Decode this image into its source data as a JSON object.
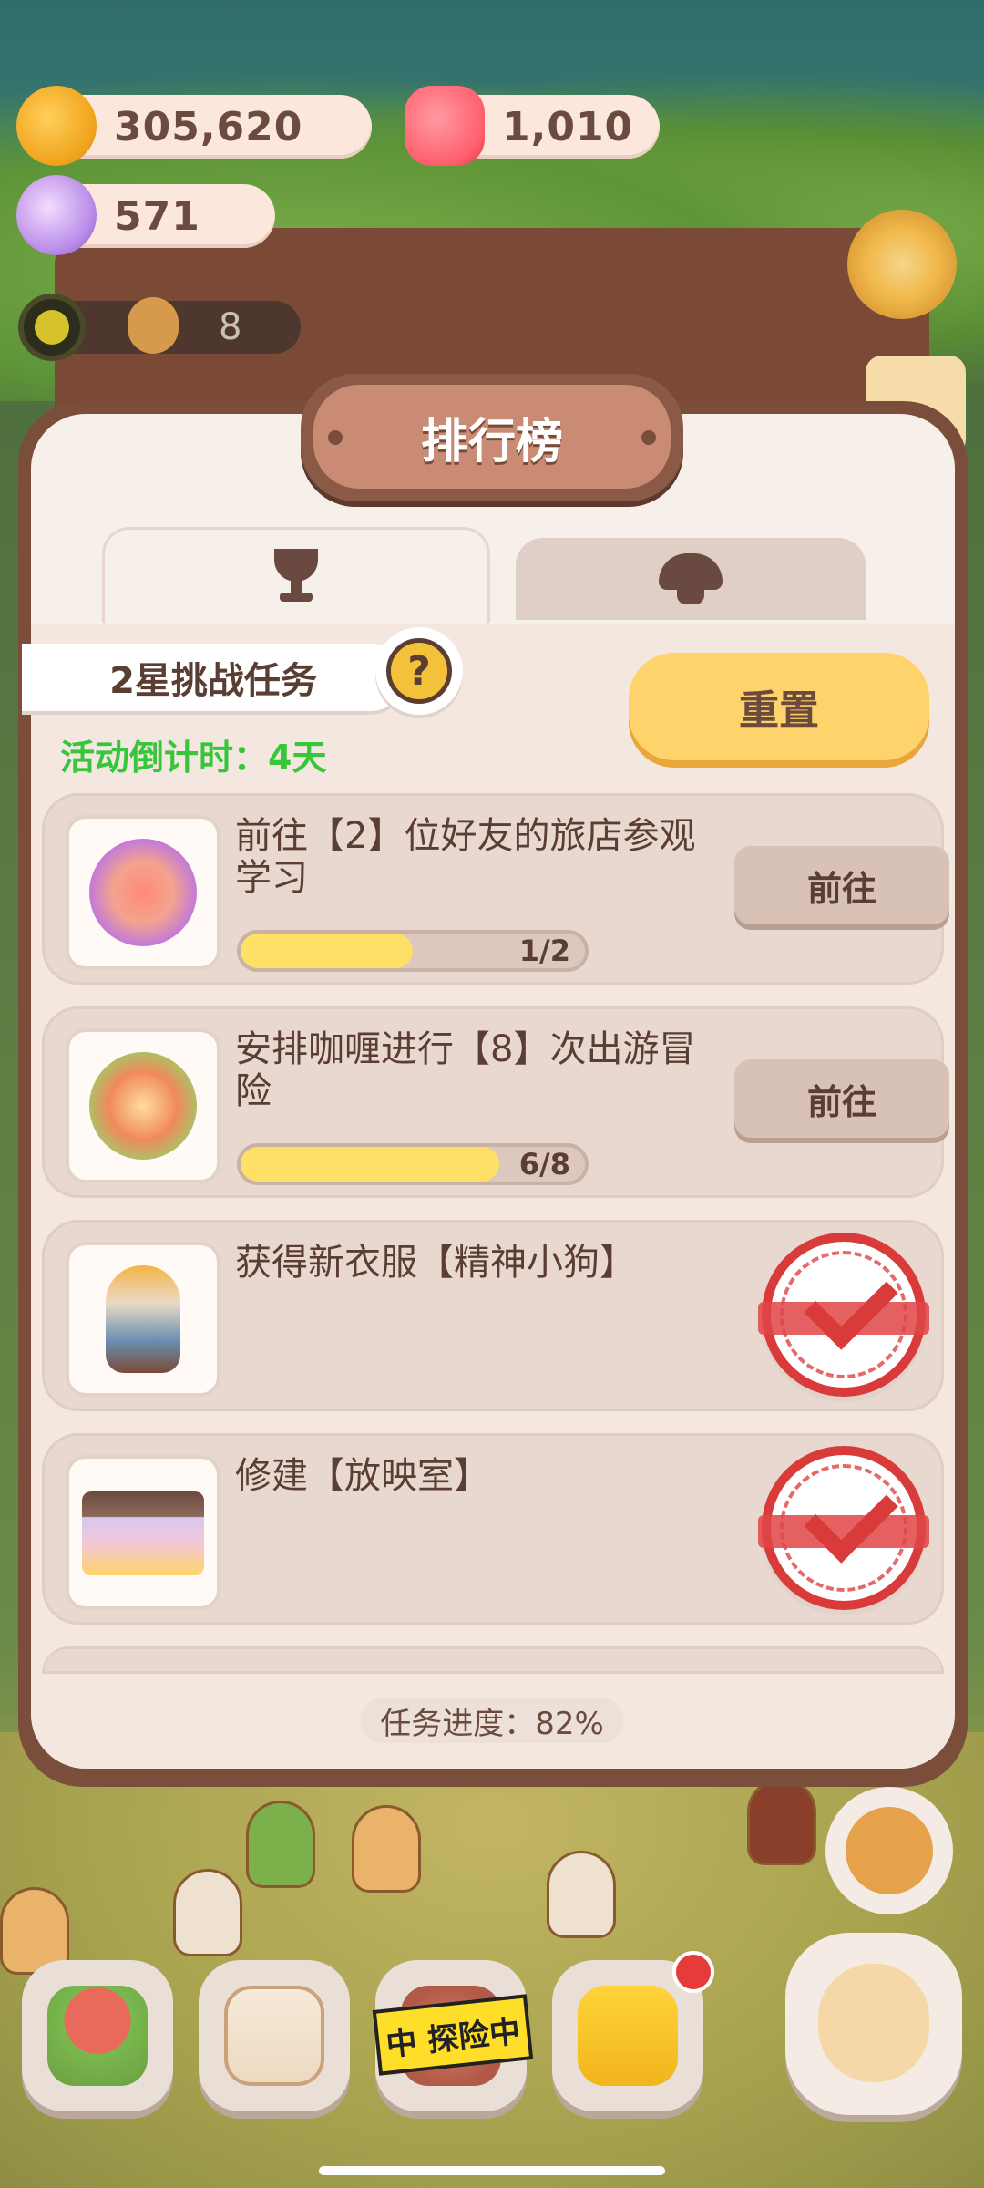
{
  "currencies": {
    "cookies": "305,620",
    "gems": "1,010",
    "crystals": "571",
    "energy_count": "8"
  },
  "panel": {
    "title": "排行榜",
    "tabs": [
      {
        "icon": "trophy-icon",
        "active": true
      },
      {
        "icon": "mushroom-icon",
        "active": false
      }
    ],
    "challenge_label": "2星挑战任务",
    "help_symbol": "?",
    "reset_label": "重置",
    "countdown": "活动倒计时：4天"
  },
  "tasks": [
    {
      "title": "前往【2】位好友的旅店参观学习",
      "progress_text": "1/2",
      "progress": 0.5,
      "action": "前往",
      "completed": false
    },
    {
      "title": "安排咖喱进行【8】次出游冒险",
      "progress_text": "6/8",
      "progress": 0.75,
      "action": "前往",
      "completed": false
    },
    {
      "title": "获得新衣服【精神小狗】",
      "completed": true
    },
    {
      "title": "修建【放映室】",
      "completed": true
    }
  ],
  "footer": {
    "progress_label": "任务进度：82%"
  },
  "bottom_nav": {
    "explore_banner": "中 探险中",
    "items": [
      "house-icon",
      "diary-icon",
      "explore-icon",
      "shop-bag-icon",
      "pet-icon"
    ]
  },
  "colors": {
    "accent_yellow": "#ffd36b",
    "countdown_green": "#37c53a",
    "stamp_red": "#d93a3a",
    "panel_brown": "#7b4d3b"
  }
}
